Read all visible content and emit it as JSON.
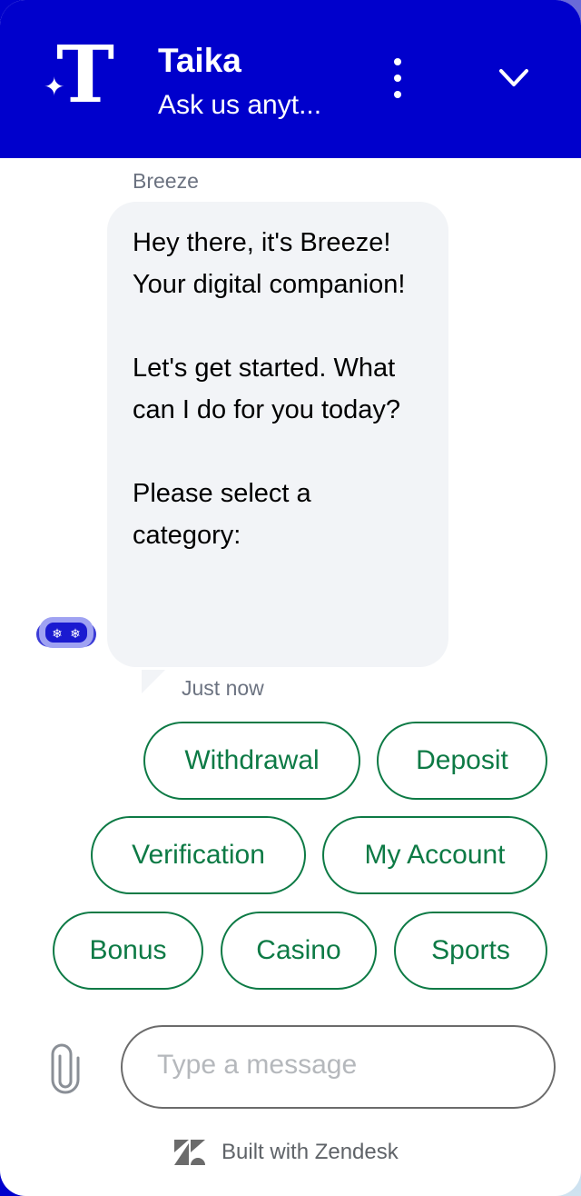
{
  "header": {
    "title": "Taika",
    "subtitle": "Ask us anyt...",
    "logo_icon": "taika-logo-icon",
    "menu_icon": "more-vertical-icon",
    "collapse_icon": "chevron-down-icon",
    "brand_color": "#0000cc"
  },
  "conversation": {
    "sender": "Breeze",
    "message": "Hey there, it's Breeze! Your digital companion!\n\nLet's get started. What can I do for you today?\n\nPlease select a category:",
    "timestamp": "Just now",
    "avatar_icon": "robot-avatar-icon"
  },
  "quick_replies": [
    {
      "label": "Withdrawal"
    },
    {
      "label": "Deposit"
    },
    {
      "label": "Verification"
    },
    {
      "label": "My Account"
    },
    {
      "label": "Bonus"
    },
    {
      "label": "Casino"
    },
    {
      "label": "Sports"
    }
  ],
  "quick_reply_color": "#0d7a45",
  "composer": {
    "placeholder": "Type a message",
    "value": "",
    "attach_icon": "paperclip-icon"
  },
  "footer": {
    "text": "Built with Zendesk",
    "logo_icon": "zendesk-logo-icon"
  }
}
